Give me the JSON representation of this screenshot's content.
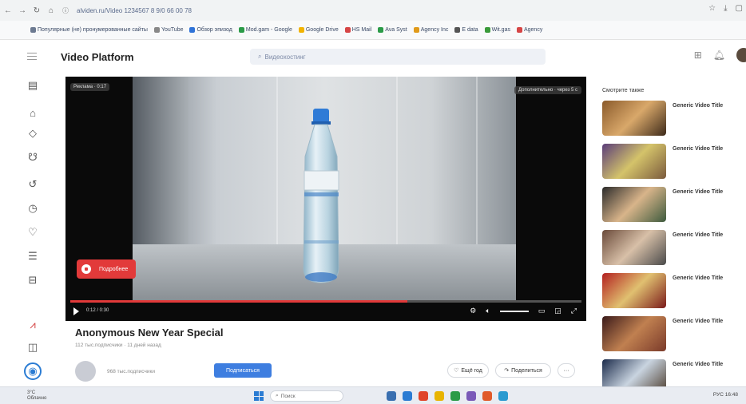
{
  "browser": {
    "url": "alviden.ru/Video 1234567 8 9/0 66 00 78",
    "bookmarks": [
      {
        "label": "Популярные (не) пронумерованные сайты",
        "color": "#6c7a91"
      },
      {
        "label": "YouTube",
        "color": "#888888"
      },
      {
        "label": "Обзор эпизод",
        "color": "#2f73d8"
      },
      {
        "label": "Mod.gam - Google",
        "color": "#2b9b48"
      },
      {
        "label": "Google Drive",
        "color": "#f2b300"
      },
      {
        "label": "HS Mail",
        "color": "#d64545"
      },
      {
        "label": "Ava Syst",
        "color": "#2b9b48"
      },
      {
        "label": "Agency Inc",
        "color": "#e09a1a"
      },
      {
        "label": "E data",
        "color": "#555555"
      },
      {
        "label": "Wit.gas",
        "color": "#3a9a3a"
      },
      {
        "label": "Agency",
        "color": "#d64545"
      }
    ]
  },
  "app": {
    "title": "Video Platform",
    "search_placeholder": "Видеохостинг"
  },
  "player": {
    "badge_left": "Реклама · 0:17",
    "badge_right": "Дополнительно · через 5 с",
    "more_button": "Подробнее",
    "time": "0:12 / 0:30",
    "progress_fraction": 0.66
  },
  "video": {
    "title": "Anonymous New Year Special",
    "meta": "112 тыс.подписчики · 11 дней назад",
    "subscribers": "968 тыс.подписчики",
    "subscribe_label": "Подписаться",
    "likes": "Ещё год",
    "share": "Поделиться",
    "more": "···"
  },
  "recommendations": {
    "heading": "Смотрите также",
    "items": [
      {
        "title": "Generic Video Title",
        "colors": [
          "#8a5a2b",
          "#d9a86a",
          "#3d2a1a"
        ]
      },
      {
        "title": "Generic Video Title",
        "colors": [
          "#5a3d7a",
          "#d4c36a",
          "#7a5a3d"
        ]
      },
      {
        "title": "Generic Video Title",
        "colors": [
          "#2a2a2a",
          "#d8b48a",
          "#3d5a3d"
        ]
      },
      {
        "title": "Generic Video Title",
        "colors": [
          "#6a4a3a",
          "#d8c0a8",
          "#4a4a4a"
        ]
      },
      {
        "title": "Generic Video Title",
        "colors": [
          "#b32020",
          "#e0c070",
          "#7a1a1a"
        ]
      },
      {
        "title": "Generic Video Title",
        "colors": [
          "#3a1a1a",
          "#c08050",
          "#7a3a2a"
        ]
      },
      {
        "title": "Generic Video Title",
        "colors": [
          "#1a2a4a",
          "#c9d4e0",
          "#4a3a2a"
        ]
      }
    ]
  },
  "taskbar": {
    "weather_temp": "3°C",
    "weather_desc": "Облачно",
    "search_label": "Поиск",
    "tray_text": "РУС  16:48",
    "apps": [
      "#3a6fb0",
      "#2b7cd3",
      "#e0442a",
      "#e8b400",
      "#2b9b48",
      "#7a5ab8",
      "#e05a2a",
      "#2a9ad0"
    ]
  }
}
